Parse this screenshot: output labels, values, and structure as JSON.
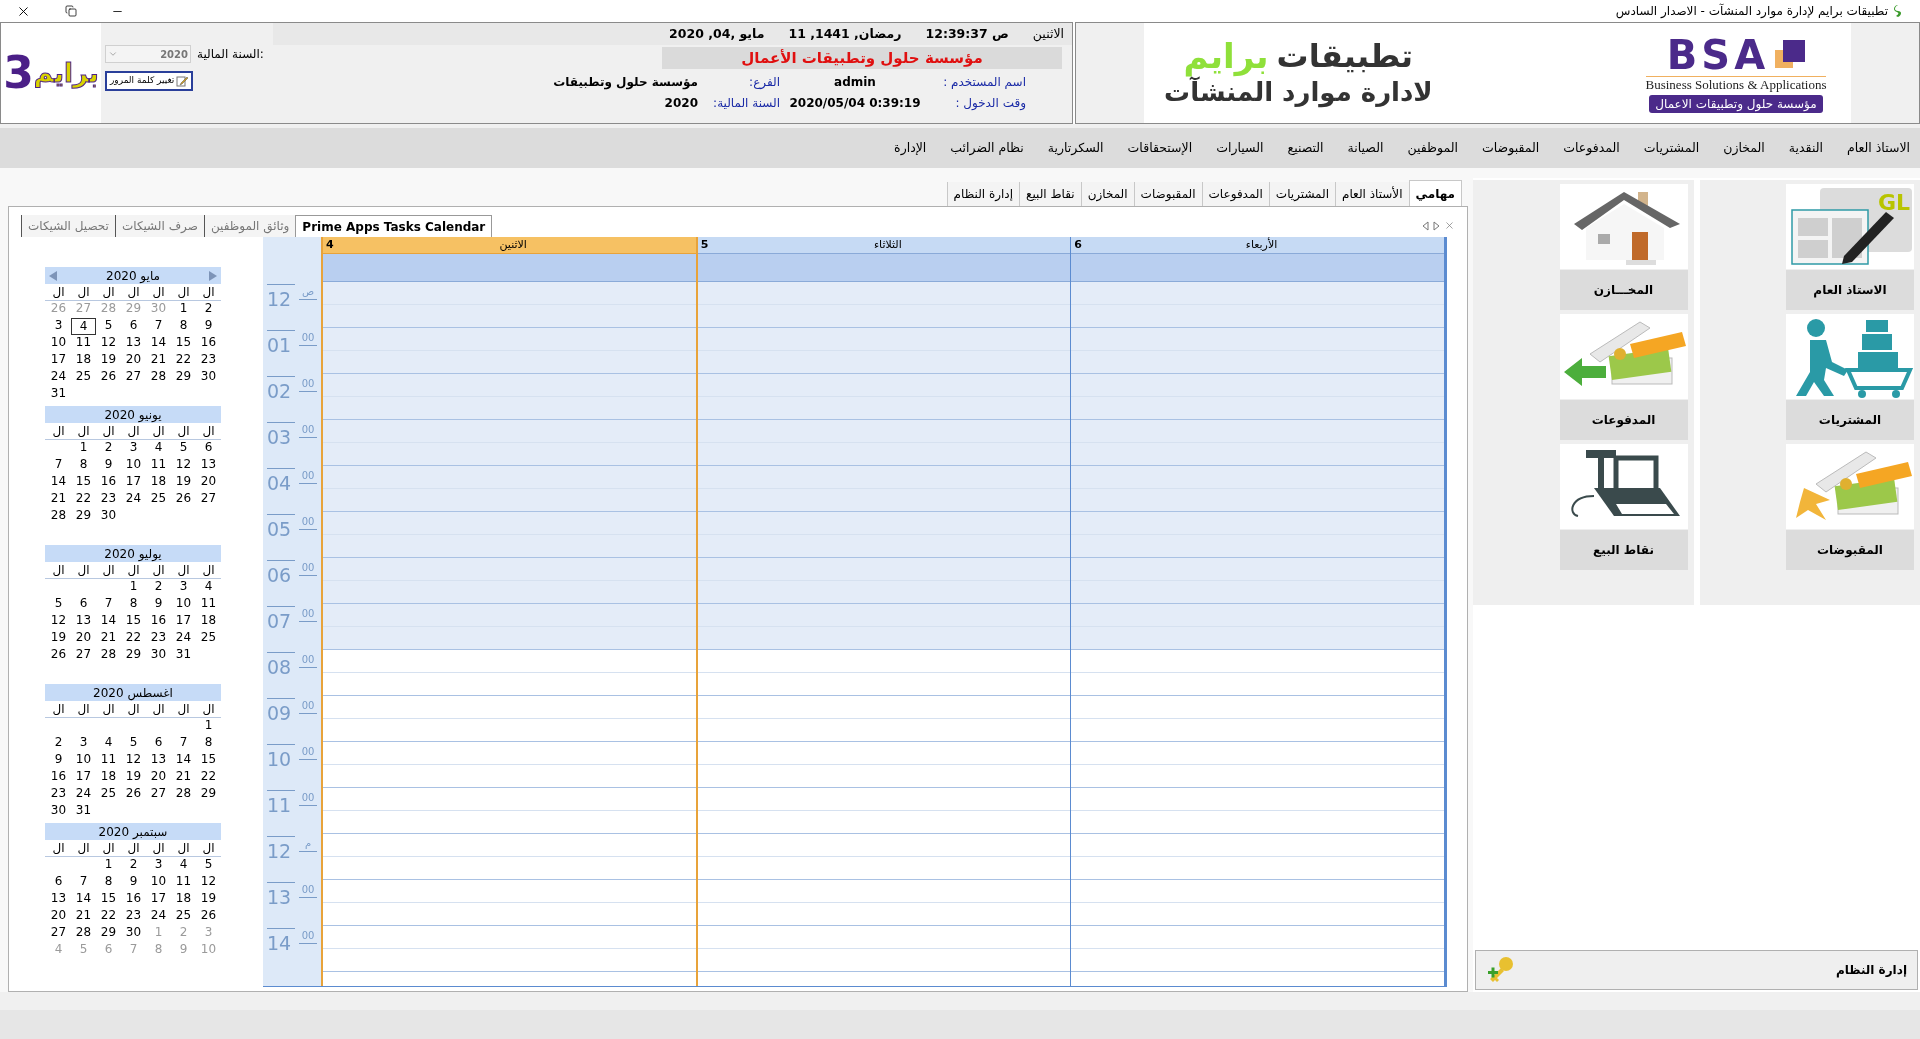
{
  "title_bar": {
    "title": "تطبيقات برايم لإدارة موارد المنشآت - الاصدار السادس"
  },
  "header": {
    "logo": {
      "word": "برايم",
      "digit": "3"
    },
    "fiscal_year": {
      "label": "السنة المالية:",
      "value": "2020"
    },
    "change_password_button": "تغيير كلمة المرور",
    "weekday": "الاثنين",
    "time": "12:39:37 ص",
    "hijri_date": "11 ,رمضان, 1441",
    "gregorian_date": "2020 ,مايو ,04",
    "company": "مؤسسة حلول وتطبيقات الأعمال",
    "info": [
      {
        "label": "اسم المستخدم :",
        "value": "admin"
      },
      {
        "label": "الفرع:",
        "value": "مؤسسة حلول وتطبيقات"
      },
      {
        "label": "وقت الدخول :",
        "value": "2020/05/04 0:39:19"
      },
      {
        "label": "السنة المالية:",
        "value": "2020"
      }
    ]
  },
  "banner": {
    "line1": "تطبيقات",
    "brand": "برايم",
    "line2": "لادارة موارد المنشآت",
    "bsa": "BSA",
    "bsa_tagline": "Business Solutions & Applications",
    "bsa_arabic": "مؤسسة حلول وتطبيقات الاعمال"
  },
  "menu": [
    "الاستاذ العام",
    "النقدية",
    "المخازن",
    "المشتريات",
    "المدفوعات",
    "المقبوضات",
    "الموظفين",
    "الصيانة",
    "التصنيع",
    "السيارات",
    "الإستحقاقات",
    "السكرتارية",
    "نظام الضرائب",
    "الإدارة"
  ],
  "module_tabs": [
    {
      "label": "مهامي",
      "selected": true
    },
    {
      "label": "الأستاذ العام",
      "selected": false
    },
    {
      "label": "المشتريات",
      "selected": false
    },
    {
      "label": "المدفوعات",
      "selected": false
    },
    {
      "label": "المقبوضات",
      "selected": false
    },
    {
      "label": "المخازن",
      "selected": false
    },
    {
      "label": "نقاط البيع",
      "selected": false
    },
    {
      "label": "إدارة النظام",
      "selected": false
    }
  ],
  "inner_tabs": [
    {
      "label": "Prime Apps Tasks Calendar",
      "selected": true
    },
    {
      "label": "وثائق الموظفين",
      "selected": false
    },
    {
      "label": "صرف الشيكات",
      "selected": false
    },
    {
      "label": "تحصيل الشيكات",
      "selected": false
    }
  ],
  "mini_calendars": [
    {
      "title": "مايو 2020",
      "nav_arrows": true,
      "weekdays": [
        "ال",
        "ال",
        "ال",
        "ال",
        "ال",
        "ال",
        "ال"
      ],
      "weeks": [
        [
          {
            "text": "2",
            "kind": "day",
            "selected": false
          },
          {
            "text": "1",
            "kind": "day",
            "selected": false
          },
          {
            "text": "30",
            "kind": "other",
            "selected": false
          },
          {
            "text": "29",
            "kind": "other",
            "selected": false
          },
          {
            "text": "28",
            "kind": "other",
            "selected": false
          },
          {
            "text": "27",
            "kind": "other",
            "selected": false
          },
          {
            "text": "26",
            "kind": "other",
            "selected": false
          }
        ],
        [
          {
            "text": "9",
            "kind": "day",
            "selected": false
          },
          {
            "text": "8",
            "kind": "day",
            "selected": false
          },
          {
            "text": "7",
            "kind": "day",
            "selected": false
          },
          {
            "text": "6",
            "kind": "day",
            "selected": false
          },
          {
            "text": "5",
            "kind": "day",
            "selected": false
          },
          {
            "text": "4",
            "kind": "day",
            "selected": true
          },
          {
            "text": "3",
            "kind": "day",
            "selected": false
          }
        ],
        [
          {
            "text": "16",
            "kind": "day",
            "selected": false
          },
          {
            "text": "15",
            "kind": "day",
            "selected": false
          },
          {
            "text": "14",
            "kind": "day",
            "selected": false
          },
          {
            "text": "13",
            "kind": "day",
            "selected": false
          },
          {
            "text": "12",
            "kind": "day",
            "selected": false
          },
          {
            "text": "11",
            "kind": "day",
            "selected": false
          },
          {
            "text": "10",
            "kind": "day",
            "selected": false
          }
        ],
        [
          {
            "text": "23",
            "kind": "day",
            "selected": false
          },
          {
            "text": "22",
            "kind": "day",
            "selected": false
          },
          {
            "text": "21",
            "kind": "day",
            "selected": false
          },
          {
            "text": "20",
            "kind": "day",
            "selected": false
          },
          {
            "text": "19",
            "kind": "day",
            "selected": false
          },
          {
            "text": "18",
            "kind": "day",
            "selected": false
          },
          {
            "text": "17",
            "kind": "day",
            "selected": false
          }
        ],
        [
          {
            "text": "30",
            "kind": "day",
            "selected": false
          },
          {
            "text": "29",
            "kind": "day",
            "selected": false
          },
          {
            "text": "28",
            "kind": "day",
            "selected": false
          },
          {
            "text": "27",
            "kind": "day",
            "selected": false
          },
          {
            "text": "26",
            "kind": "day",
            "selected": false
          },
          {
            "text": "25",
            "kind": "day",
            "selected": false
          },
          {
            "text": "24",
            "kind": "day",
            "selected": false
          }
        ],
        [
          {
            "kind": "blank",
            "selected": false
          },
          {
            "kind": "blank",
            "selected": false
          },
          {
            "kind": "blank",
            "selected": false
          },
          {
            "kind": "blank",
            "selected": false
          },
          {
            "kind": "blank",
            "selected": false
          },
          {
            "kind": "blank",
            "selected": false
          },
          {
            "text": "31",
            "kind": "day",
            "selected": false
          }
        ]
      ]
    },
    {
      "title": "يونيو 2020",
      "nav_arrows": false,
      "weekdays": [
        "ال",
        "ال",
        "ال",
        "ال",
        "ال",
        "ال",
        "ال"
      ],
      "weeks": [
        [
          {
            "text": "6",
            "kind": "day",
            "selected": false
          },
          {
            "text": "5",
            "kind": "day",
            "selected": false
          },
          {
            "text": "4",
            "kind": "day",
            "selected": false
          },
          {
            "text": "3",
            "kind": "day",
            "selected": false
          },
          {
            "text": "2",
            "kind": "day",
            "selected": false
          },
          {
            "text": "1",
            "kind": "day",
            "selected": false
          }
        ],
        [
          {
            "text": "13",
            "kind": "day",
            "selected": false
          },
          {
            "text": "12",
            "kind": "day",
            "selected": false
          },
          {
            "text": "11",
            "kind": "day",
            "selected": false
          },
          {
            "text": "10",
            "kind": "day",
            "selected": false
          },
          {
            "text": "9",
            "kind": "day",
            "selected": false
          },
          {
            "text": "8",
            "kind": "day",
            "selected": false
          },
          {
            "text": "7",
            "kind": "day",
            "selected": false
          }
        ],
        [
          {
            "text": "20",
            "kind": "day",
            "selected": false
          },
          {
            "text": "19",
            "kind": "day",
            "selected": false
          },
          {
            "text": "18",
            "kind": "day",
            "selected": false
          },
          {
            "text": "17",
            "kind": "day",
            "selected": false
          },
          {
            "text": "16",
            "kind": "day",
            "selected": false
          },
          {
            "text": "15",
            "kind": "day",
            "selected": false
          },
          {
            "text": "14",
            "kind": "day",
            "selected": false
          }
        ],
        [
          {
            "text": "27",
            "kind": "day",
            "selected": false
          },
          {
            "text": "26",
            "kind": "day",
            "selected": false
          },
          {
            "text": "25",
            "kind": "day",
            "selected": false
          },
          {
            "text": "24",
            "kind": "day",
            "selected": false
          },
          {
            "text": "23",
            "kind": "day",
            "selected": false
          },
          {
            "text": "22",
            "kind": "day",
            "selected": false
          },
          {
            "text": "21",
            "kind": "day",
            "selected": false
          }
        ],
        [
          {
            "kind": "blank",
            "selected": false
          },
          {
            "kind": "blank",
            "selected": false
          },
          {
            "kind": "blank",
            "selected": false
          },
          {
            "kind": "blank",
            "selected": false
          },
          {
            "text": "30",
            "kind": "day",
            "selected": false
          },
          {
            "text": "29",
            "kind": "day",
            "selected": false
          },
          {
            "text": "28",
            "kind": "day",
            "selected": false
          }
        ]
      ]
    },
    {
      "title": "يوليو 2020",
      "nav_arrows": false,
      "weekdays": [
        "ال",
        "ال",
        "ال",
        "ال",
        "ال",
        "ال",
        "ال"
      ],
      "weeks": [
        [
          {
            "text": "4",
            "kind": "day",
            "selected": false
          },
          {
            "text": "3",
            "kind": "day",
            "selected": false
          },
          {
            "text": "2",
            "kind": "day",
            "selected": false
          },
          {
            "text": "1",
            "kind": "day",
            "selected": false
          }
        ],
        [
          {
            "text": "11",
            "kind": "day",
            "selected": false
          },
          {
            "text": "10",
            "kind": "day",
            "selected": false
          },
          {
            "text": "9",
            "kind": "day",
            "selected": false
          },
          {
            "text": "8",
            "kind": "day",
            "selected": false
          },
          {
            "text": "7",
            "kind": "day",
            "selected": false
          },
          {
            "text": "6",
            "kind": "day",
            "selected": false
          },
          {
            "text": "5",
            "kind": "day",
            "selected": false
          }
        ],
        [
          {
            "text": "18",
            "kind": "day",
            "selected": false
          },
          {
            "text": "17",
            "kind": "day",
            "selected": false
          },
          {
            "text": "16",
            "kind": "day",
            "selected": false
          },
          {
            "text": "15",
            "kind": "day",
            "selected": false
          },
          {
            "text": "14",
            "kind": "day",
            "selected": false
          },
          {
            "text": "13",
            "kind": "day",
            "selected": false
          },
          {
            "text": "12",
            "kind": "day",
            "selected": false
          }
        ],
        [
          {
            "text": "25",
            "kind": "day",
            "selected": false
          },
          {
            "text": "24",
            "kind": "day",
            "selected": false
          },
          {
            "text": "23",
            "kind": "day",
            "selected": false
          },
          {
            "text": "22",
            "kind": "day",
            "selected": false
          },
          {
            "text": "21",
            "kind": "day",
            "selected": false
          },
          {
            "text": "20",
            "kind": "day",
            "selected": false
          },
          {
            "text": "19",
            "kind": "day",
            "selected": false
          }
        ],
        [
          {
            "kind": "blank",
            "selected": false
          },
          {
            "text": "31",
            "kind": "day",
            "selected": false
          },
          {
            "text": "30",
            "kind": "day",
            "selected": false
          },
          {
            "text": "29",
            "kind": "day",
            "selected": false
          },
          {
            "text": "28",
            "kind": "day",
            "selected": false
          },
          {
            "text": "27",
            "kind": "day",
            "selected": false
          },
          {
            "text": "26",
            "kind": "day",
            "selected": false
          }
        ]
      ]
    },
    {
      "title": "اغسطس 2020",
      "nav_arrows": false,
      "weekdays": [
        "ال",
        "ال",
        "ال",
        "ال",
        "ال",
        "ال",
        "ال"
      ],
      "weeks": [
        [
          {
            "text": "1",
            "kind": "day",
            "selected": false
          }
        ],
        [
          {
            "text": "8",
            "kind": "day",
            "selected": false
          },
          {
            "text": "7",
            "kind": "day",
            "selected": false
          },
          {
            "text": "6",
            "kind": "day",
            "selected": false
          },
          {
            "text": "5",
            "kind": "day",
            "selected": false
          },
          {
            "text": "4",
            "kind": "day",
            "selected": false
          },
          {
            "text": "3",
            "kind": "day",
            "selected": false
          },
          {
            "text": "2",
            "kind": "day",
            "selected": false
          }
        ],
        [
          {
            "text": "15",
            "kind": "day",
            "selected": false
          },
          {
            "text": "14",
            "kind": "day",
            "selected": false
          },
          {
            "text": "13",
            "kind": "day",
            "selected": false
          },
          {
            "text": "12",
            "kind": "day",
            "selected": false
          },
          {
            "text": "11",
            "kind": "day",
            "selected": false
          },
          {
            "text": "10",
            "kind": "day",
            "selected": false
          },
          {
            "text": "9",
            "kind": "day",
            "selected": false
          }
        ],
        [
          {
            "text": "22",
            "kind": "day",
            "selected": false
          },
          {
            "text": "21",
            "kind": "day",
            "selected": false
          },
          {
            "text": "20",
            "kind": "day",
            "selected": false
          },
          {
            "text": "19",
            "kind": "day",
            "selected": false
          },
          {
            "text": "18",
            "kind": "day",
            "selected": false
          },
          {
            "text": "17",
            "kind": "day",
            "selected": false
          },
          {
            "text": "16",
            "kind": "day",
            "selected": false
          }
        ],
        [
          {
            "text": "29",
            "kind": "day",
            "selected": false
          },
          {
            "text": "28",
            "kind": "day",
            "selected": false
          },
          {
            "text": "27",
            "kind": "day",
            "selected": false
          },
          {
            "text": "26",
            "kind": "day",
            "selected": false
          },
          {
            "text": "25",
            "kind": "day",
            "selected": false
          },
          {
            "text": "24",
            "kind": "day",
            "selected": false
          },
          {
            "text": "23",
            "kind": "day",
            "selected": false
          }
        ],
        [
          {
            "kind": "blank",
            "selected": false
          },
          {
            "kind": "blank",
            "selected": false
          },
          {
            "kind": "blank",
            "selected": false
          },
          {
            "kind": "blank",
            "selected": false
          },
          {
            "kind": "blank",
            "selected": false
          },
          {
            "text": "31",
            "kind": "day",
            "selected": false
          },
          {
            "text": "30",
            "kind": "day",
            "selected": false
          }
        ]
      ]
    },
    {
      "title": "سبتمبر 2020",
      "nav_arrows": false,
      "weekdays": [
        "ال",
        "ال",
        "ال",
        "ال",
        "ال",
        "ال",
        "ال"
      ],
      "weeks": [
        [
          {
            "text": "5",
            "kind": "day",
            "selected": false
          },
          {
            "text": "4",
            "kind": "day",
            "selected": false
          },
          {
            "text": "3",
            "kind": "day",
            "selected": false
          },
          {
            "text": "2",
            "kind": "day",
            "selected": false
          },
          {
            "text": "1",
            "kind": "day",
            "selected": false
          }
        ],
        [
          {
            "text": "12",
            "kind": "day",
            "selected": false
          },
          {
            "text": "11",
            "kind": "day",
            "selected": false
          },
          {
            "text": "10",
            "kind": "day",
            "selected": false
          },
          {
            "text": "9",
            "kind": "day",
            "selected": false
          },
          {
            "text": "8",
            "kind": "day",
            "selected": false
          },
          {
            "text": "7",
            "kind": "day",
            "selected": false
          },
          {
            "text": "6",
            "kind": "day",
            "selected": false
          }
        ],
        [
          {
            "text": "19",
            "kind": "day",
            "selected": false
          },
          {
            "text": "18",
            "kind": "day",
            "selected": false
          },
          {
            "text": "17",
            "kind": "day",
            "selected": false
          },
          {
            "text": "16",
            "kind": "day",
            "selected": false
          },
          {
            "text": "15",
            "kind": "day",
            "selected": false
          },
          {
            "text": "14",
            "kind": "day",
            "selected": false
          },
          {
            "text": "13",
            "kind": "day",
            "selected": false
          }
        ],
        [
          {
            "text": "26",
            "kind": "day",
            "selected": false
          },
          {
            "text": "25",
            "kind": "day",
            "selected": false
          },
          {
            "text": "24",
            "kind": "day",
            "selected": false
          },
          {
            "text": "23",
            "kind": "day",
            "selected": false
          },
          {
            "text": "22",
            "kind": "day",
            "selected": false
          },
          {
            "text": "21",
            "kind": "day",
            "selected": false
          },
          {
            "text": "20",
            "kind": "day",
            "selected": false
          }
        ],
        [
          {
            "text": "3",
            "kind": "other",
            "selected": false
          },
          {
            "text": "2",
            "kind": "other",
            "selected": false
          },
          {
            "text": "1",
            "kind": "other",
            "selected": false
          },
          {
            "text": "30",
            "kind": "day",
            "selected": false
          },
          {
            "text": "29",
            "kind": "day",
            "selected": false
          },
          {
            "text": "28",
            "kind": "day",
            "selected": false
          },
          {
            "text": "27",
            "kind": "day",
            "selected": false
          }
        ],
        [
          {
            "text": "10",
            "kind": "other",
            "selected": false
          },
          {
            "text": "9",
            "kind": "other",
            "selected": false
          },
          {
            "text": "8",
            "kind": "other",
            "selected": false
          },
          {
            "text": "7",
            "kind": "other",
            "selected": false
          },
          {
            "text": "6",
            "kind": "other",
            "selected": false
          },
          {
            "text": "5",
            "kind": "other",
            "selected": false
          },
          {
            "text": "4",
            "kind": "other",
            "selected": false
          }
        ]
      ]
    }
  ],
  "scheduler": {
    "days": [
      {
        "number": "6",
        "name": "الأربعاء",
        "selected": false
      },
      {
        "number": "5",
        "name": "الثلاثاء",
        "selected": false
      },
      {
        "number": "4",
        "name": "الاثنين",
        "selected": true
      }
    ],
    "hours": [
      {
        "hour": "12",
        "suffix": "ص",
        "working": false
      },
      {
        "hour": "01",
        "suffix": "00",
        "working": false
      },
      {
        "hour": "02",
        "suffix": "00",
        "working": false
      },
      {
        "hour": "03",
        "suffix": "00",
        "working": false
      },
      {
        "hour": "04",
        "suffix": "00",
        "working": false
      },
      {
        "hour": "05",
        "suffix": "00",
        "working": false
      },
      {
        "hour": "06",
        "suffix": "00",
        "working": false
      },
      {
        "hour": "07",
        "suffix": "00",
        "working": false
      },
      {
        "hour": "08",
        "suffix": "00",
        "working": true
      },
      {
        "hour": "09",
        "suffix": "00",
        "working": true
      },
      {
        "hour": "10",
        "suffix": "00",
        "working": true
      },
      {
        "hour": "11",
        "suffix": "00",
        "working": true
      },
      {
        "hour": "12",
        "suffix": "م",
        "working": true
      },
      {
        "hour": "13",
        "suffix": "00",
        "working": true
      },
      {
        "hour": "14",
        "suffix": "00",
        "working": true
      }
    ]
  },
  "tiles": [
    {
      "label": "الاستاذ العام",
      "badge": "GL"
    },
    {
      "label": "المخـــازن"
    },
    {
      "label": "المشتريات"
    },
    {
      "label": "المدفوعات"
    },
    {
      "label": "المقبوضات"
    },
    {
      "label": "نقاط البيع"
    }
  ],
  "system_admin": "إدارة النظام"
}
